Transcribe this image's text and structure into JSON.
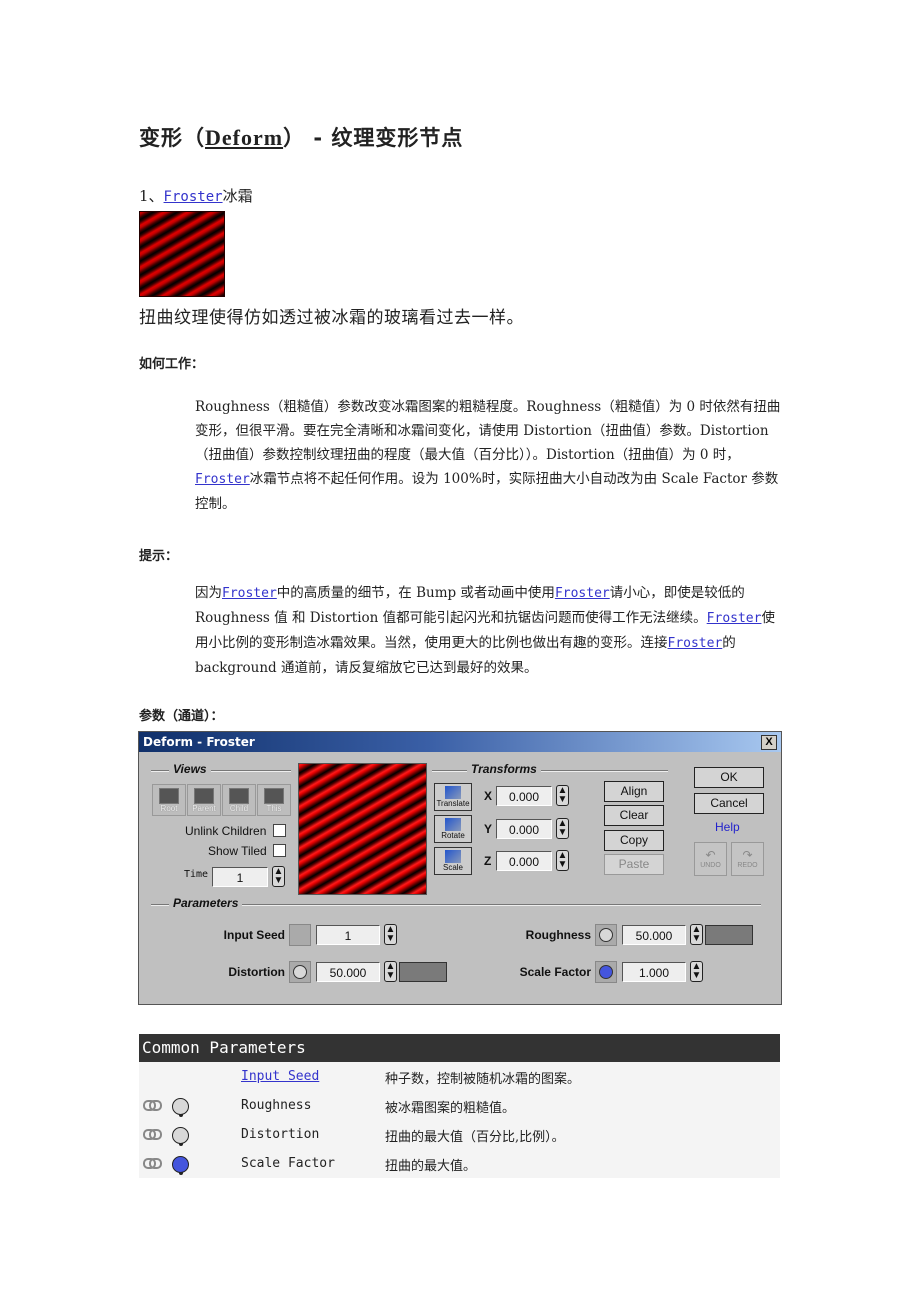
{
  "heading": {
    "prefix": "变形（",
    "deform": "Deform",
    "suffix": "） - 纹理变形节点"
  },
  "item1": {
    "number": "1、",
    "link": "Froster",
    "label": "冰霜"
  },
  "description": "扭曲纹理使得仿如透过被冰霜的玻璃看过去一样。",
  "how_it_works": {
    "heading": "如何工作：",
    "part1": "Roughness（粗糙值）参数改变冰霜图案的粗糙程度。Roughness（粗糙值）为 0 时依然有扭曲变形，但很平滑。要在完全清晰和冰霜间变化，请使用 Distortion（扭曲值）参数。Distortion（扭曲值）参数控制纹理扭曲的程度（最大值（百分比））。Distortion（扭曲值）为 0 时，",
    "link": "Froster",
    "part2": "冰霜节点将不起任何作用。设为 100%时，实际扭曲大小自动改为由 Scale Factor 参数控制。"
  },
  "tips": {
    "heading": "提示：",
    "t1": "因为",
    "link1": "Froster",
    "t2": "中的高质量的细节，在 Bump 或者动画中使用",
    "link2": "Froster",
    "t3": "请小心，即使是较低的 Roughness 值 和 Distortion 值都可能引起闪光和抗锯齿问题而使得工作无法继续。",
    "link3": "Froster",
    "t4": "使用小比例的变形制造冰霜效果。当然，使用更大的比例也做出有趣的变形。连接",
    "link4": "Froster",
    "t5": "的 background 通道前，请反复缩放它已达到最好的效果。"
  },
  "params_heading": "参数（通道）：",
  "dialog": {
    "title": "Deform  - Froster",
    "close": "X",
    "views": {
      "header": "Views",
      "buttons": [
        "Root",
        "Parent",
        "Child",
        "This"
      ],
      "unlink_children": "Unlink Children",
      "show_tiled": "Show Tiled",
      "time_label": "Time",
      "time_value": "1"
    },
    "transforms": {
      "header": "Transforms",
      "buttons": [
        "Translate",
        "Rotate",
        "Scale"
      ],
      "x_label": "X",
      "x_value": "0.000",
      "y_label": "Y",
      "y_value": "0.000",
      "z_label": "Z",
      "z_value": "0.000",
      "align": "Align",
      "clear": "Clear",
      "copy": "Copy",
      "paste": "Paste"
    },
    "actions": {
      "ok": "OK",
      "cancel": "Cancel",
      "help": "Help",
      "undo": "UNDO",
      "redo": "REDO"
    },
    "parameters": {
      "header": "Parameters",
      "input_seed_label": "Input Seed",
      "input_seed_value": "1",
      "distortion_label": "Distortion",
      "distortion_value": "50.000",
      "roughness_label": "Roughness",
      "roughness_value": "50.000",
      "scale_factor_label": "Scale Factor",
      "scale_factor_value": "1.000"
    },
    "colors": {
      "channel_gray": "#d8d8d8",
      "channel_blue": "#4455dd"
    }
  },
  "common_parameters": {
    "title": "Common Parameters",
    "rows": [
      {
        "name": "Input Seed",
        "desc": "种子数，控制被随机冰霜的图案。",
        "is_link": true
      },
      {
        "name": "Roughness",
        "desc": "被冰霜图案的粗糙值。",
        "channel": "gray"
      },
      {
        "name": "Distortion",
        "desc": "扭曲的最大值（百分比,比例）。",
        "channel": "gray"
      },
      {
        "name": "Scale Factor",
        "desc": "扭曲的最大值。",
        "channel": "blue"
      }
    ]
  }
}
